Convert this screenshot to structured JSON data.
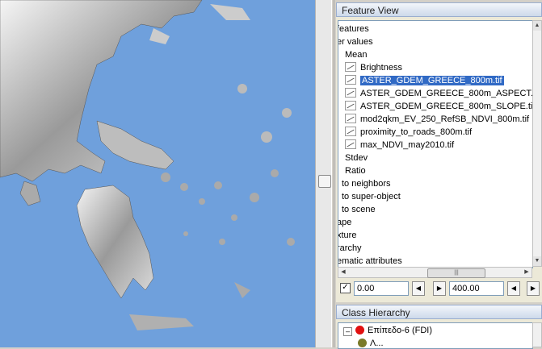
{
  "colors": {
    "sea": "#6fa0dc",
    "selection": "#316ac5",
    "class_red": "#e11010",
    "class_olive": "#7a7a2a"
  },
  "feature_view": {
    "title": "Feature View",
    "rows": [
      {
        "label": "features",
        "indent": 0,
        "icon": false
      },
      {
        "label": "er values",
        "indent": 0,
        "icon": false
      },
      {
        "label": "Mean",
        "indent": 1,
        "icon": false
      },
      {
        "label": "Brightness",
        "indent": 2,
        "icon": true
      },
      {
        "label": "ASTER_GDEM_GREECE_800m.tif",
        "indent": 2,
        "icon": true,
        "selected": true
      },
      {
        "label": "ASTER_GDEM_GREECE_800m_ASPECT.t",
        "indent": 2,
        "icon": true
      },
      {
        "label": "ASTER_GDEM_GREECE_800m_SLOPE.tif",
        "indent": 2,
        "icon": true
      },
      {
        "label": "mod2qkm_EV_250_RefSB_NDVI_800m.tif",
        "indent": 2,
        "icon": true
      },
      {
        "label": "proximity_to_roads_800m.tif",
        "indent": 2,
        "icon": true
      },
      {
        "label": "max_NDVI_may2010.tif",
        "indent": 2,
        "icon": true
      },
      {
        "label": "Stdev",
        "indent": 1,
        "icon": false
      },
      {
        "label": "Ratio",
        "indent": 1,
        "icon": false
      },
      {
        "label": "to neighbors",
        "indent": 0.5,
        "icon": false
      },
      {
        "label": "to super-object",
        "indent": 0.5,
        "icon": false
      },
      {
        "label": "to scene",
        "indent": 0.5,
        "icon": false
      },
      {
        "label": "ape",
        "indent": 0,
        "icon": false
      },
      {
        "label": "xture",
        "indent": 0,
        "icon": false
      },
      {
        "label": "rarchy",
        "indent": 0,
        "icon": false
      },
      {
        "label": "ematic attributes",
        "indent": 0,
        "icon": false
      }
    ],
    "range": {
      "enabled": true,
      "min": "0.00",
      "max": "400.00"
    }
  },
  "class_hierarchy": {
    "title": "Class Hierarchy",
    "items": [
      {
        "label": "Επίπεδο-6 (FDI)",
        "color": "#e11010",
        "expander": "–"
      },
      {
        "label": "Λ...",
        "color": "#7a7a2a",
        "expander": ""
      }
    ]
  }
}
